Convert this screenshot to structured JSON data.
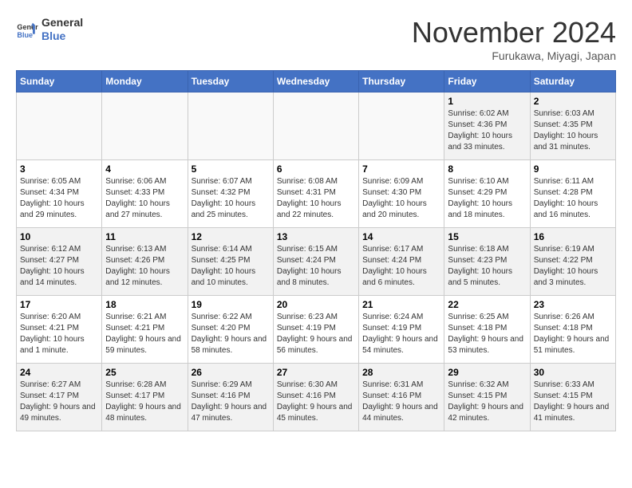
{
  "header": {
    "logo_line1": "General",
    "logo_line2": "Blue",
    "month": "November 2024",
    "location": "Furukawa, Miyagi, Japan"
  },
  "weekdays": [
    "Sunday",
    "Monday",
    "Tuesday",
    "Wednesday",
    "Thursday",
    "Friday",
    "Saturday"
  ],
  "weeks": [
    [
      {
        "day": "",
        "info": ""
      },
      {
        "day": "",
        "info": ""
      },
      {
        "day": "",
        "info": ""
      },
      {
        "day": "",
        "info": ""
      },
      {
        "day": "",
        "info": ""
      },
      {
        "day": "1",
        "info": "Sunrise: 6:02 AM\nSunset: 4:36 PM\nDaylight: 10 hours and 33 minutes."
      },
      {
        "day": "2",
        "info": "Sunrise: 6:03 AM\nSunset: 4:35 PM\nDaylight: 10 hours and 31 minutes."
      }
    ],
    [
      {
        "day": "3",
        "info": "Sunrise: 6:05 AM\nSunset: 4:34 PM\nDaylight: 10 hours and 29 minutes."
      },
      {
        "day": "4",
        "info": "Sunrise: 6:06 AM\nSunset: 4:33 PM\nDaylight: 10 hours and 27 minutes."
      },
      {
        "day": "5",
        "info": "Sunrise: 6:07 AM\nSunset: 4:32 PM\nDaylight: 10 hours and 25 minutes."
      },
      {
        "day": "6",
        "info": "Sunrise: 6:08 AM\nSunset: 4:31 PM\nDaylight: 10 hours and 22 minutes."
      },
      {
        "day": "7",
        "info": "Sunrise: 6:09 AM\nSunset: 4:30 PM\nDaylight: 10 hours and 20 minutes."
      },
      {
        "day": "8",
        "info": "Sunrise: 6:10 AM\nSunset: 4:29 PM\nDaylight: 10 hours and 18 minutes."
      },
      {
        "day": "9",
        "info": "Sunrise: 6:11 AM\nSunset: 4:28 PM\nDaylight: 10 hours and 16 minutes."
      }
    ],
    [
      {
        "day": "10",
        "info": "Sunrise: 6:12 AM\nSunset: 4:27 PM\nDaylight: 10 hours and 14 minutes."
      },
      {
        "day": "11",
        "info": "Sunrise: 6:13 AM\nSunset: 4:26 PM\nDaylight: 10 hours and 12 minutes."
      },
      {
        "day": "12",
        "info": "Sunrise: 6:14 AM\nSunset: 4:25 PM\nDaylight: 10 hours and 10 minutes."
      },
      {
        "day": "13",
        "info": "Sunrise: 6:15 AM\nSunset: 4:24 PM\nDaylight: 10 hours and 8 minutes."
      },
      {
        "day": "14",
        "info": "Sunrise: 6:17 AM\nSunset: 4:24 PM\nDaylight: 10 hours and 6 minutes."
      },
      {
        "day": "15",
        "info": "Sunrise: 6:18 AM\nSunset: 4:23 PM\nDaylight: 10 hours and 5 minutes."
      },
      {
        "day": "16",
        "info": "Sunrise: 6:19 AM\nSunset: 4:22 PM\nDaylight: 10 hours and 3 minutes."
      }
    ],
    [
      {
        "day": "17",
        "info": "Sunrise: 6:20 AM\nSunset: 4:21 PM\nDaylight: 10 hours and 1 minute."
      },
      {
        "day": "18",
        "info": "Sunrise: 6:21 AM\nSunset: 4:21 PM\nDaylight: 9 hours and 59 minutes."
      },
      {
        "day": "19",
        "info": "Sunrise: 6:22 AM\nSunset: 4:20 PM\nDaylight: 9 hours and 58 minutes."
      },
      {
        "day": "20",
        "info": "Sunrise: 6:23 AM\nSunset: 4:19 PM\nDaylight: 9 hours and 56 minutes."
      },
      {
        "day": "21",
        "info": "Sunrise: 6:24 AM\nSunset: 4:19 PM\nDaylight: 9 hours and 54 minutes."
      },
      {
        "day": "22",
        "info": "Sunrise: 6:25 AM\nSunset: 4:18 PM\nDaylight: 9 hours and 53 minutes."
      },
      {
        "day": "23",
        "info": "Sunrise: 6:26 AM\nSunset: 4:18 PM\nDaylight: 9 hours and 51 minutes."
      }
    ],
    [
      {
        "day": "24",
        "info": "Sunrise: 6:27 AM\nSunset: 4:17 PM\nDaylight: 9 hours and 49 minutes."
      },
      {
        "day": "25",
        "info": "Sunrise: 6:28 AM\nSunset: 4:17 PM\nDaylight: 9 hours and 48 minutes."
      },
      {
        "day": "26",
        "info": "Sunrise: 6:29 AM\nSunset: 4:16 PM\nDaylight: 9 hours and 47 minutes."
      },
      {
        "day": "27",
        "info": "Sunrise: 6:30 AM\nSunset: 4:16 PM\nDaylight: 9 hours and 45 minutes."
      },
      {
        "day": "28",
        "info": "Sunrise: 6:31 AM\nSunset: 4:16 PM\nDaylight: 9 hours and 44 minutes."
      },
      {
        "day": "29",
        "info": "Sunrise: 6:32 AM\nSunset: 4:15 PM\nDaylight: 9 hours and 42 minutes."
      },
      {
        "day": "30",
        "info": "Sunrise: 6:33 AM\nSunset: 4:15 PM\nDaylight: 9 hours and 41 minutes."
      }
    ]
  ]
}
